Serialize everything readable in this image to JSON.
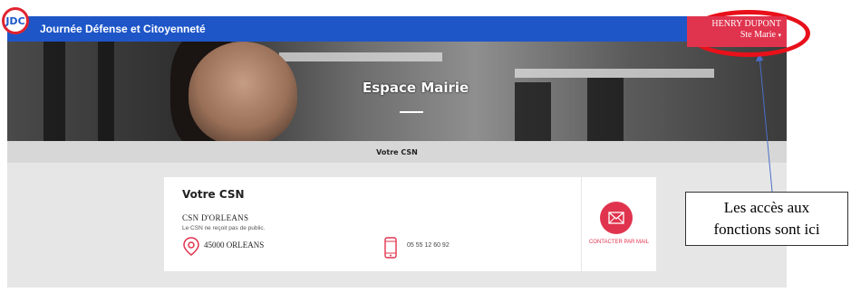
{
  "header": {
    "logo_text": "JDC",
    "app_title": "Journée Défense et Citoyenneté",
    "user_name": "HENRY DUPONT",
    "user_org": "Ste Marie",
    "user_caret": "▾"
  },
  "hero": {
    "title": "Espace Mairie"
  },
  "subnav": {
    "label": "Votre CSN"
  },
  "card": {
    "title": "Votre CSN",
    "name": "CSN D'ORLEANS",
    "note": "Le CSN ne reçoit pas de public.",
    "city": "45000 ORLEANS",
    "phone": "05 55 12 60 92",
    "pin_icon": "location-pin-icon",
    "phone_icon": "mobile-phone-icon"
  },
  "contact": {
    "label": "CONTACTER PAR MAIL",
    "icon": "envelope-icon"
  },
  "annotation": {
    "line1": "Les accès aux",
    "line2": "fonctions sont ici"
  },
  "colors": {
    "topbar": "#1e56c8",
    "accent": "#e0344e",
    "annotation_red": "#e8101a"
  }
}
